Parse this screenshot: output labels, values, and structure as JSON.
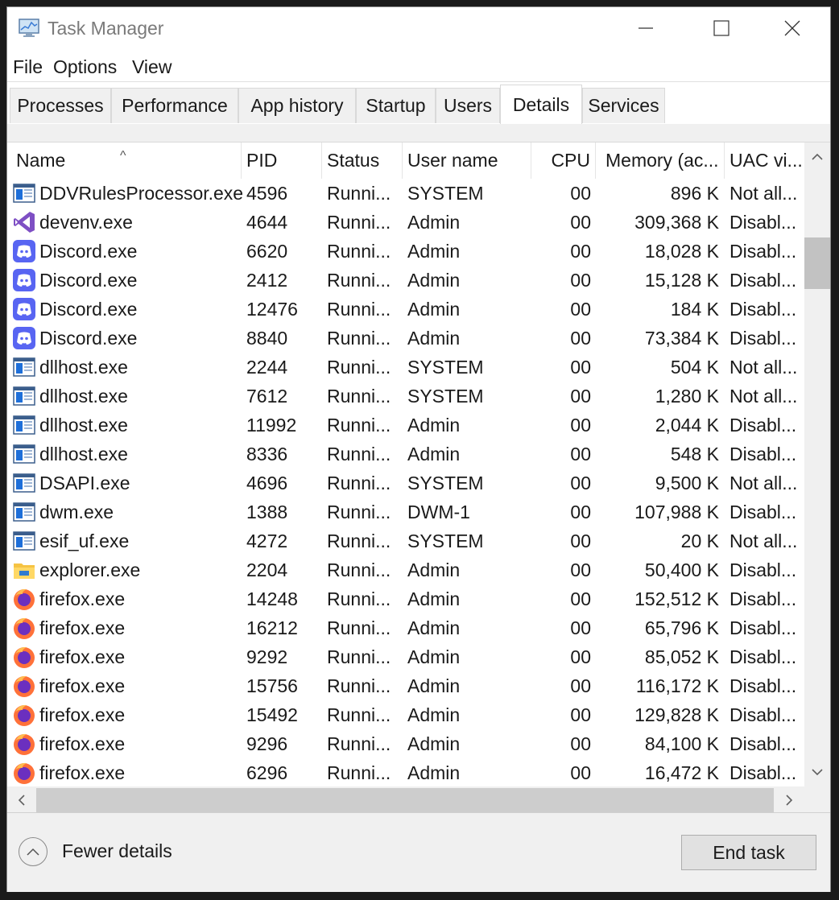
{
  "window": {
    "title": "Task Manager"
  },
  "menu": [
    "File",
    "Options",
    "View"
  ],
  "tabs": [
    {
      "label": "Processes",
      "active": false
    },
    {
      "label": "Performance",
      "active": false
    },
    {
      "label": "App history",
      "active": false
    },
    {
      "label": "Startup",
      "active": false
    },
    {
      "label": "Users",
      "active": false
    },
    {
      "label": "Details",
      "active": true
    },
    {
      "label": "Services",
      "active": false
    }
  ],
  "columns": [
    "Name",
    "PID",
    "Status",
    "User name",
    "CPU",
    "Memory (ac...",
    "UAC vi..."
  ],
  "rows": [
    {
      "icon": "window-app-icon",
      "name": "DDVRulesProcessor.exe",
      "pid": "4596",
      "status": "Runni...",
      "user": "SYSTEM",
      "cpu": "00",
      "memory": "896 K",
      "uac": "Not all..."
    },
    {
      "icon": "visual-studio-icon",
      "name": "devenv.exe",
      "pid": "4644",
      "status": "Runni...",
      "user": "Admin",
      "cpu": "00",
      "memory": "309,368 K",
      "uac": "Disabl..."
    },
    {
      "icon": "discord-icon",
      "name": "Discord.exe",
      "pid": "6620",
      "status": "Runni...",
      "user": "Admin",
      "cpu": "00",
      "memory": "18,028 K",
      "uac": "Disabl..."
    },
    {
      "icon": "discord-icon",
      "name": "Discord.exe",
      "pid": "2412",
      "status": "Runni...",
      "user": "Admin",
      "cpu": "00",
      "memory": "15,128 K",
      "uac": "Disabl..."
    },
    {
      "icon": "discord-icon",
      "name": "Discord.exe",
      "pid": "12476",
      "status": "Runni...",
      "user": "Admin",
      "cpu": "00",
      "memory": "184 K",
      "uac": "Disabl..."
    },
    {
      "icon": "discord-icon",
      "name": "Discord.exe",
      "pid": "8840",
      "status": "Runni...",
      "user": "Admin",
      "cpu": "00",
      "memory": "73,384 K",
      "uac": "Disabl..."
    },
    {
      "icon": "window-app-icon",
      "name": "dllhost.exe",
      "pid": "2244",
      "status": "Runni...",
      "user": "SYSTEM",
      "cpu": "00",
      "memory": "504 K",
      "uac": "Not all..."
    },
    {
      "icon": "window-app-icon",
      "name": "dllhost.exe",
      "pid": "7612",
      "status": "Runni...",
      "user": "SYSTEM",
      "cpu": "00",
      "memory": "1,280 K",
      "uac": "Not all..."
    },
    {
      "icon": "window-app-icon",
      "name": "dllhost.exe",
      "pid": "11992",
      "status": "Runni...",
      "user": "Admin",
      "cpu": "00",
      "memory": "2,044 K",
      "uac": "Disabl..."
    },
    {
      "icon": "window-app-icon",
      "name": "dllhost.exe",
      "pid": "8336",
      "status": "Runni...",
      "user": "Admin",
      "cpu": "00",
      "memory": "548 K",
      "uac": "Disabl..."
    },
    {
      "icon": "window-app-icon",
      "name": "DSAPI.exe",
      "pid": "4696",
      "status": "Runni...",
      "user": "SYSTEM",
      "cpu": "00",
      "memory": "9,500 K",
      "uac": "Not all..."
    },
    {
      "icon": "window-app-icon",
      "name": "dwm.exe",
      "pid": "1388",
      "status": "Runni...",
      "user": "DWM-1",
      "cpu": "00",
      "memory": "107,988 K",
      "uac": "Disabl..."
    },
    {
      "icon": "window-app-icon",
      "name": "esif_uf.exe",
      "pid": "4272",
      "status": "Runni...",
      "user": "SYSTEM",
      "cpu": "00",
      "memory": "20 K",
      "uac": "Not all..."
    },
    {
      "icon": "file-explorer-icon",
      "name": "explorer.exe",
      "pid": "2204",
      "status": "Runni...",
      "user": "Admin",
      "cpu": "00",
      "memory": "50,400 K",
      "uac": "Disabl..."
    },
    {
      "icon": "firefox-icon",
      "name": "firefox.exe",
      "pid": "14248",
      "status": "Runni...",
      "user": "Admin",
      "cpu": "00",
      "memory": "152,512 K",
      "uac": "Disabl..."
    },
    {
      "icon": "firefox-icon",
      "name": "firefox.exe",
      "pid": "16212",
      "status": "Runni...",
      "user": "Admin",
      "cpu": "00",
      "memory": "65,796 K",
      "uac": "Disabl..."
    },
    {
      "icon": "firefox-icon",
      "name": "firefox.exe",
      "pid": "9292",
      "status": "Runni...",
      "user": "Admin",
      "cpu": "00",
      "memory": "85,052 K",
      "uac": "Disabl..."
    },
    {
      "icon": "firefox-icon",
      "name": "firefox.exe",
      "pid": "15756",
      "status": "Runni...",
      "user": "Admin",
      "cpu": "00",
      "memory": "116,172 K",
      "uac": "Disabl..."
    },
    {
      "icon": "firefox-icon",
      "name": "firefox.exe",
      "pid": "15492",
      "status": "Runni...",
      "user": "Admin",
      "cpu": "00",
      "memory": "129,828 K",
      "uac": "Disabl..."
    },
    {
      "icon": "firefox-icon",
      "name": "firefox.exe",
      "pid": "9296",
      "status": "Runni...",
      "user": "Admin",
      "cpu": "00",
      "memory": "84,100 K",
      "uac": "Disabl..."
    },
    {
      "icon": "firefox-icon",
      "name": "firefox.exe",
      "pid": "6296",
      "status": "Runni...",
      "user": "Admin",
      "cpu": "00",
      "memory": "16,472 K",
      "uac": "Disabl..."
    }
  ],
  "footer": {
    "fewer_details": "Fewer details",
    "end_task": "End task"
  },
  "colors": {
    "discord": "#5865F2",
    "visual_studio": "#7E4FC4",
    "firefox_orange": "#FF7139",
    "firefox_purple": "#6B2FBF",
    "explorer_yellow": "#F6C343",
    "app_blue": "#1E6FD9"
  }
}
